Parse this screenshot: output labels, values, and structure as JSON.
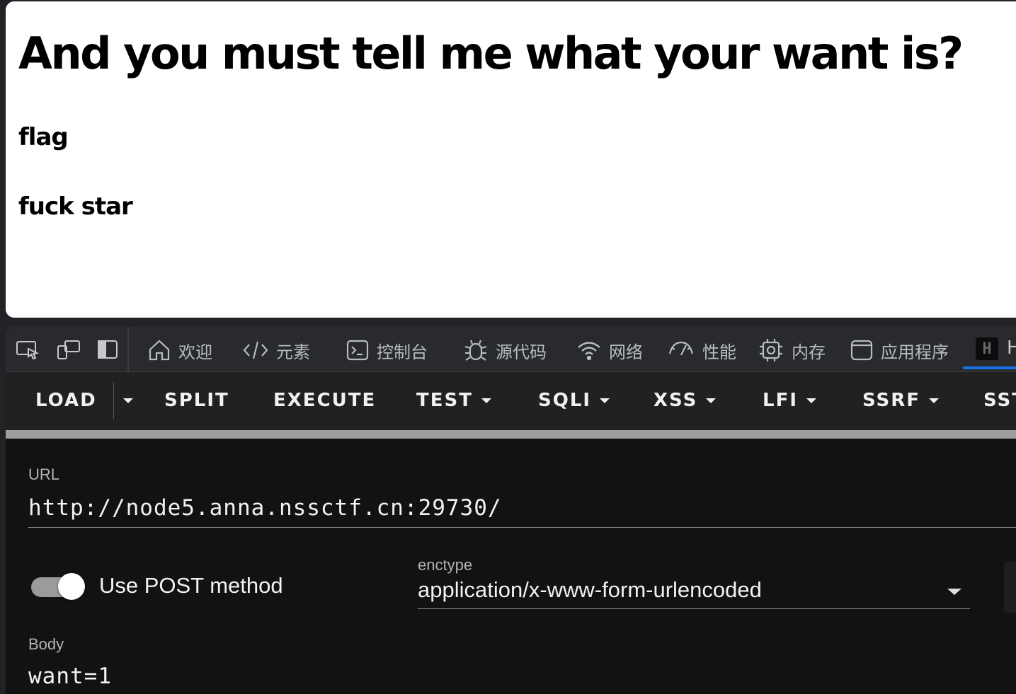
{
  "page": {
    "heading": "And you must tell me what your want is?",
    "line1": "flag",
    "line2": "fuck star"
  },
  "devtools": {
    "tabs": [
      {
        "label": "欢迎",
        "icon": "home-icon"
      },
      {
        "label": "元素",
        "icon": "code-icon"
      },
      {
        "label": "控制台",
        "icon": "console-icon"
      },
      {
        "label": "源代码",
        "icon": "bug-icon"
      },
      {
        "label": "网络",
        "icon": "wifi-icon"
      },
      {
        "label": "性能",
        "icon": "gauge-icon"
      },
      {
        "label": "内存",
        "icon": "chip-icon"
      },
      {
        "label": "应用程序",
        "icon": "window-icon"
      }
    ],
    "hackbar_tab_badge": "H",
    "hackbar_tab_label": "H"
  },
  "hackbar": {
    "toolbar": {
      "load": "LOAD",
      "split": "SPLIT",
      "execute": "EXECUTE",
      "test": "TEST",
      "sqli": "SQLI",
      "xss": "XSS",
      "lfi": "LFI",
      "ssrf": "SSRF",
      "ssti": "SST"
    },
    "url_label": "URL",
    "url_value": "http://node5.anna.nssctf.cn:29730/",
    "post_toggle_on": true,
    "post_label": "Use POST method",
    "enctype_label": "enctype",
    "enctype_value": "application/x-www-form-urlencoded",
    "body_label": "Body",
    "body_value": "want=1"
  },
  "colors": {
    "accent": "#1a73e8",
    "panel_bg": "#121212",
    "toolbar_bg": "#212121"
  }
}
